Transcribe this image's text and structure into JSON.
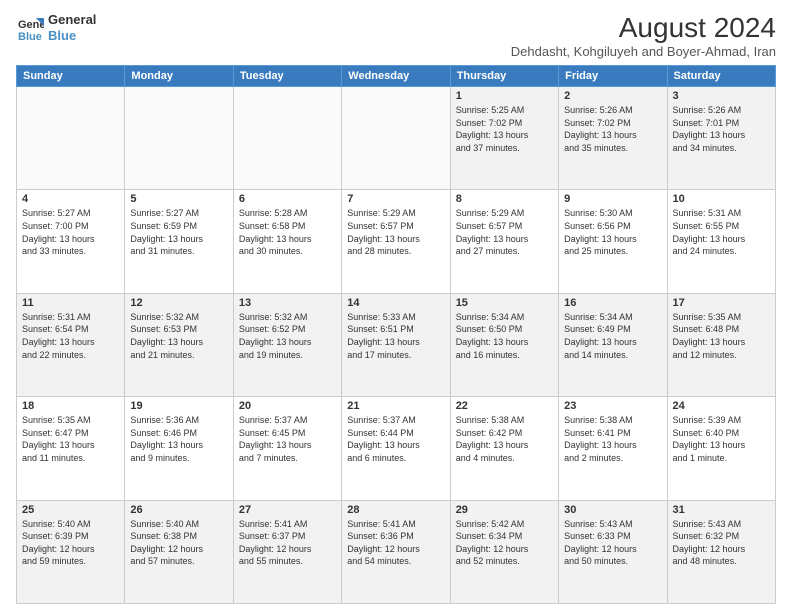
{
  "logo": {
    "line1": "General",
    "line2": "Blue"
  },
  "title": "August 2024",
  "subtitle": "Dehdasht, Kohgiluyeh and Boyer-Ahmad, Iran",
  "columns": [
    "Sunday",
    "Monday",
    "Tuesday",
    "Wednesday",
    "Thursday",
    "Friday",
    "Saturday"
  ],
  "weeks": [
    [
      {
        "day": "",
        "content": ""
      },
      {
        "day": "",
        "content": ""
      },
      {
        "day": "",
        "content": ""
      },
      {
        "day": "",
        "content": ""
      },
      {
        "day": "1",
        "content": "Sunrise: 5:25 AM\nSunset: 7:02 PM\nDaylight: 13 hours\nand 37 minutes."
      },
      {
        "day": "2",
        "content": "Sunrise: 5:26 AM\nSunset: 7:02 PM\nDaylight: 13 hours\nand 35 minutes."
      },
      {
        "day": "3",
        "content": "Sunrise: 5:26 AM\nSunset: 7:01 PM\nDaylight: 13 hours\nand 34 minutes."
      }
    ],
    [
      {
        "day": "4",
        "content": "Sunrise: 5:27 AM\nSunset: 7:00 PM\nDaylight: 13 hours\nand 33 minutes."
      },
      {
        "day": "5",
        "content": "Sunrise: 5:27 AM\nSunset: 6:59 PM\nDaylight: 13 hours\nand 31 minutes."
      },
      {
        "day": "6",
        "content": "Sunrise: 5:28 AM\nSunset: 6:58 PM\nDaylight: 13 hours\nand 30 minutes."
      },
      {
        "day": "7",
        "content": "Sunrise: 5:29 AM\nSunset: 6:57 PM\nDaylight: 13 hours\nand 28 minutes."
      },
      {
        "day": "8",
        "content": "Sunrise: 5:29 AM\nSunset: 6:57 PM\nDaylight: 13 hours\nand 27 minutes."
      },
      {
        "day": "9",
        "content": "Sunrise: 5:30 AM\nSunset: 6:56 PM\nDaylight: 13 hours\nand 25 minutes."
      },
      {
        "day": "10",
        "content": "Sunrise: 5:31 AM\nSunset: 6:55 PM\nDaylight: 13 hours\nand 24 minutes."
      }
    ],
    [
      {
        "day": "11",
        "content": "Sunrise: 5:31 AM\nSunset: 6:54 PM\nDaylight: 13 hours\nand 22 minutes."
      },
      {
        "day": "12",
        "content": "Sunrise: 5:32 AM\nSunset: 6:53 PM\nDaylight: 13 hours\nand 21 minutes."
      },
      {
        "day": "13",
        "content": "Sunrise: 5:32 AM\nSunset: 6:52 PM\nDaylight: 13 hours\nand 19 minutes."
      },
      {
        "day": "14",
        "content": "Sunrise: 5:33 AM\nSunset: 6:51 PM\nDaylight: 13 hours\nand 17 minutes."
      },
      {
        "day": "15",
        "content": "Sunrise: 5:34 AM\nSunset: 6:50 PM\nDaylight: 13 hours\nand 16 minutes."
      },
      {
        "day": "16",
        "content": "Sunrise: 5:34 AM\nSunset: 6:49 PM\nDaylight: 13 hours\nand 14 minutes."
      },
      {
        "day": "17",
        "content": "Sunrise: 5:35 AM\nSunset: 6:48 PM\nDaylight: 13 hours\nand 12 minutes."
      }
    ],
    [
      {
        "day": "18",
        "content": "Sunrise: 5:35 AM\nSunset: 6:47 PM\nDaylight: 13 hours\nand 11 minutes."
      },
      {
        "day": "19",
        "content": "Sunrise: 5:36 AM\nSunset: 6:46 PM\nDaylight: 13 hours\nand 9 minutes."
      },
      {
        "day": "20",
        "content": "Sunrise: 5:37 AM\nSunset: 6:45 PM\nDaylight: 13 hours\nand 7 minutes."
      },
      {
        "day": "21",
        "content": "Sunrise: 5:37 AM\nSunset: 6:44 PM\nDaylight: 13 hours\nand 6 minutes."
      },
      {
        "day": "22",
        "content": "Sunrise: 5:38 AM\nSunset: 6:42 PM\nDaylight: 13 hours\nand 4 minutes."
      },
      {
        "day": "23",
        "content": "Sunrise: 5:38 AM\nSunset: 6:41 PM\nDaylight: 13 hours\nand 2 minutes."
      },
      {
        "day": "24",
        "content": "Sunrise: 5:39 AM\nSunset: 6:40 PM\nDaylight: 13 hours\nand 1 minute."
      }
    ],
    [
      {
        "day": "25",
        "content": "Sunrise: 5:40 AM\nSunset: 6:39 PM\nDaylight: 12 hours\nand 59 minutes."
      },
      {
        "day": "26",
        "content": "Sunrise: 5:40 AM\nSunset: 6:38 PM\nDaylight: 12 hours\nand 57 minutes."
      },
      {
        "day": "27",
        "content": "Sunrise: 5:41 AM\nSunset: 6:37 PM\nDaylight: 12 hours\nand 55 minutes."
      },
      {
        "day": "28",
        "content": "Sunrise: 5:41 AM\nSunset: 6:36 PM\nDaylight: 12 hours\nand 54 minutes."
      },
      {
        "day": "29",
        "content": "Sunrise: 5:42 AM\nSunset: 6:34 PM\nDaylight: 12 hours\nand 52 minutes."
      },
      {
        "day": "30",
        "content": "Sunrise: 5:43 AM\nSunset: 6:33 PM\nDaylight: 12 hours\nand 50 minutes."
      },
      {
        "day": "31",
        "content": "Sunrise: 5:43 AM\nSunset: 6:32 PM\nDaylight: 12 hours\nand 48 minutes."
      }
    ]
  ]
}
